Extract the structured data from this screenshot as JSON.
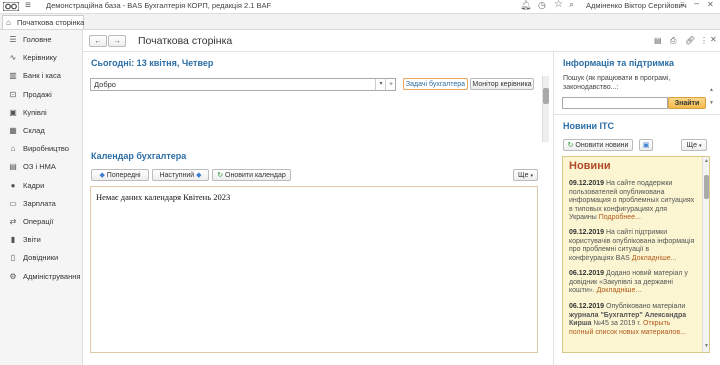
{
  "app": {
    "title": "Демонстраційна база - BAS Бухгалтерія КОРП, редакція 2.1 BAF",
    "user": "Адміненко Віктор Сергійович"
  },
  "tabs": [
    {
      "label": "Початкова сторінка"
    }
  ],
  "sidebar": {
    "items": [
      {
        "label": "Головне",
        "icon": "menu-icon"
      },
      {
        "label": "Керівнику",
        "icon": "chart-icon"
      },
      {
        "label": "Банк і каса",
        "icon": "bank-icon"
      },
      {
        "label": "Продажі",
        "icon": "cart-icon"
      },
      {
        "label": "Купівлі",
        "icon": "bag-icon"
      },
      {
        "label": "Склад",
        "icon": "box-icon"
      },
      {
        "label": "Виробництво",
        "icon": "factory-icon"
      },
      {
        "label": "ОЗ і НМА",
        "icon": "building-icon"
      },
      {
        "label": "Кадри",
        "icon": "person-icon"
      },
      {
        "label": "Зарплата",
        "icon": "wallet-icon"
      },
      {
        "label": "Операції",
        "icon": "operations-icon"
      },
      {
        "label": "Звіти",
        "icon": "reports-icon"
      },
      {
        "label": "Довідники",
        "icon": "book-icon"
      },
      {
        "label": "Адміністрування",
        "icon": "gear-icon"
      }
    ]
  },
  "page": {
    "title": "Початкова сторінка"
  },
  "today": {
    "heading": "Сьогодні: 13 квітня, Четвер",
    "greeting_value": "Добро",
    "btn_tasks": "Задачі бухгалтера",
    "btn_monitor": "Монітор керівника"
  },
  "calendar": {
    "heading": "Календар бухгалтера",
    "btn_prev": "Попередні",
    "btn_next": "Наступний",
    "btn_refresh": "Оновити календар",
    "btn_more": "Ще",
    "empty_text": "Немає даних календаря Квітень 2023"
  },
  "support": {
    "heading": "Інформація та підтримка",
    "search_label": "Пошук (як працювати в програмі, законодавство...:",
    "search_value": "",
    "btn_find": "Знайти"
  },
  "itc": {
    "heading": "Новини ІТС",
    "btn_refresh": "Оновити новини",
    "btn_more": "Ще",
    "news_title": "Новини",
    "news": [
      {
        "date": "09.12.2019",
        "text": "На сайте поддержки пользователей опубликована информация о проблемных ситуациях в типовых конфигурациях для Украины",
        "link": "Подробнее..."
      },
      {
        "date": "09.12.2019",
        "text": "На сайті підтримки користувачів опублікована інформація про проблемні ситуації в конфігураціях BAS",
        "link": "Докладніше..."
      },
      {
        "date": "06.12.2019",
        "text": "Додано новий матеріал у довідник «Закупівлі за державні кошти».",
        "link": "Докладніше..."
      },
      {
        "date": "06.12.2019",
        "text_pre": "Опубліковано матеріали",
        "text_bold": "журнала \"Бухгалтер\" Александра Кирша",
        "text_post": "№45 за 2019 г.",
        "link": "Открыть полный список новых материалов..."
      }
    ]
  }
}
